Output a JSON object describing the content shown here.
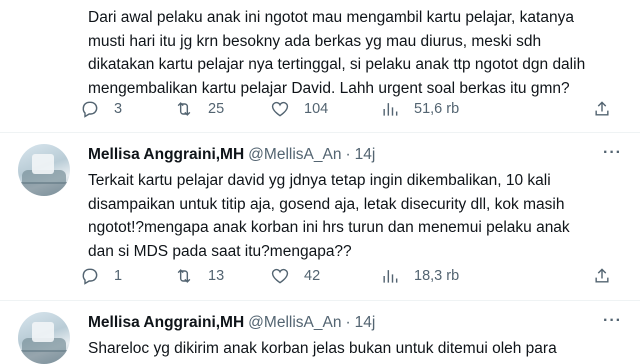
{
  "tweets": [
    {
      "lines": [
        "Dari awal pelaku anak ini ngotot mau mengambil kartu pelajar, katanya",
        "musti hari itu jg krn besokny ada berkas yg mau diurus, meski sdh",
        "dikatakan kartu pelajar nya tertinggal, si pelaku anak ttp ngotot dgn dalih",
        "mengembalikan kartu pelajar David. Lahh urgent soal berkas itu gmn?"
      ],
      "replies": "3",
      "retweets": "25",
      "likes": "104",
      "views": "51,6 rb"
    },
    {
      "name": "Mellisa Anggraini,MH",
      "handle": "@MellisA_An",
      "dot": "·",
      "time": "14j",
      "more": "···",
      "lines": [
        "Terkait kartu pelajar david yg jdnya tetap ingin dikembalikan, 10 kali",
        "disampaikan untuk titip aja, gosend aja, letak disecurity dll, kok masih",
        "ngotot!?mengapa anak korban ini hrs turun dan menemui pelaku anak",
        "dan si MDS pada saat itu?mengapa??"
      ],
      "replies": "1",
      "retweets": "13",
      "likes": "42",
      "views": "18,3 rb"
    },
    {
      "name": "Mellisa Anggraini,MH",
      "handle": "@MellisA_An",
      "dot": "·",
      "time": "14j",
      "more": "···",
      "lines": [
        "Shareloc yg dikirim anak korban jelas bukan untuk ditemui oleh para"
      ]
    }
  ]
}
